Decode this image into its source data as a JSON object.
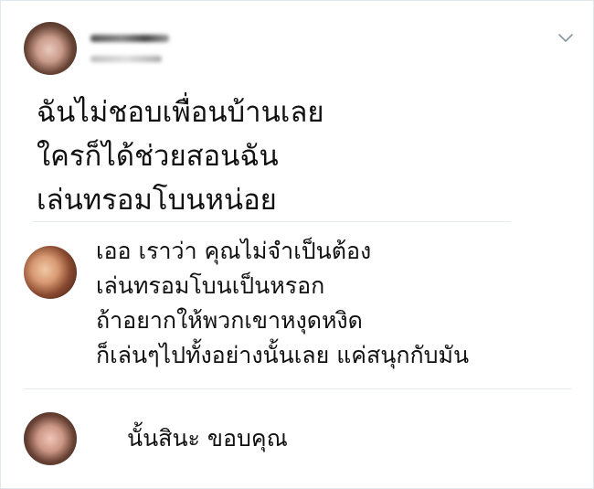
{
  "post": {
    "lines": [
      "ฉันไม่ชอบเพื่อนบ้านเลย",
      "ใครก็ได้ช่วยสอนฉัน",
      "เล่นทรอมโบนหน่อย"
    ]
  },
  "reply": {
    "lines": [
      "เออ เราว่า คุณไม่จำเป็นต้อง",
      "เล่นทรอมโบนเป็นหรอก",
      "ถ้าอยากให้พวกเขาหงุดหงิด",
      "ก็เล่นๆไปทั้งอย่างนั้นเลย แค่สนุกกับมัน"
    ]
  },
  "reply2": {
    "text": "นั้นสินะ ขอบคุณ"
  },
  "icons": {
    "menu": "chevron-down-icon"
  },
  "colors": {
    "text": "#111111",
    "divider": "#e6ecf0",
    "chevron": "#8899a6"
  }
}
